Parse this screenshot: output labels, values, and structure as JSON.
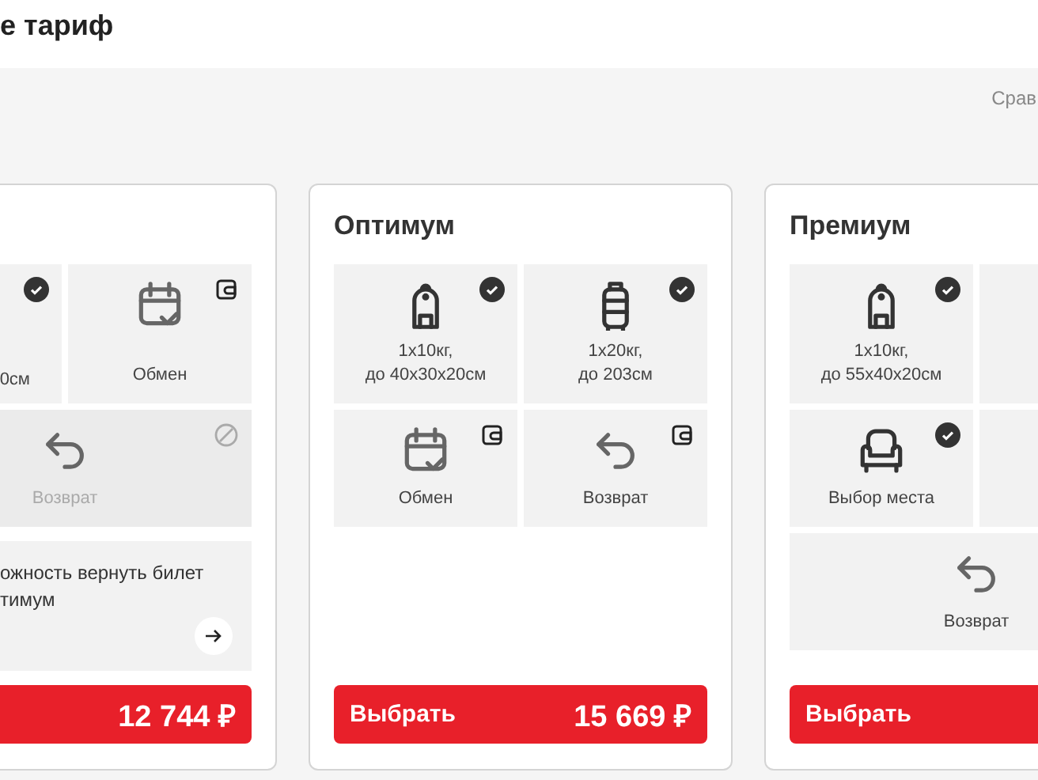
{
  "header": {
    "title": "е тариф",
    "compare_link": "Срав"
  },
  "tariffs": [
    {
      "features": [
        {
          "label": "0см",
          "included": true,
          "paid": false,
          "disabled": false
        },
        {
          "kind": "calendar",
          "label": "Обмен",
          "included": false,
          "paid": true,
          "disabled": false
        },
        {
          "kind": "return",
          "label": "Возврат",
          "included": false,
          "paid": false,
          "disabled": true
        }
      ],
      "info": {
        "text": "ожность вернуть билет\nтимум"
      },
      "price": "12 744 ₽"
    },
    {
      "title": "Оптимум",
      "features": [
        {
          "kind": "backpack",
          "label": "1x10кг,\nдо 40x30x20см",
          "included": true,
          "paid": false,
          "disabled": false
        },
        {
          "kind": "suitcase",
          "label": "1x20кг,\nдо 203см",
          "included": true,
          "paid": false,
          "disabled": false
        },
        {
          "kind": "calendar",
          "label": "Обмен",
          "included": false,
          "paid": true,
          "disabled": false
        },
        {
          "kind": "return",
          "label": "Возврат",
          "included": false,
          "paid": true,
          "disabled": false
        }
      ],
      "select_label": "Выбрать",
      "price": "15 669 ₽"
    },
    {
      "title": "Премиум",
      "features": [
        {
          "kind": "backpack",
          "label": "1x10кг,\nдо 55x40x20см",
          "included": true,
          "paid": false,
          "disabled": false
        },
        {
          "included": false,
          "paid": false,
          "disabled": false
        },
        {
          "kind": "seat",
          "label": "Выбор места",
          "included": true,
          "paid": false,
          "disabled": false
        },
        {
          "included": false,
          "paid": false,
          "disabled": false
        },
        {
          "kind": "return",
          "label": "Возврат",
          "included": false,
          "paid": false,
          "disabled": false
        }
      ],
      "select_label": "Выбрать"
    }
  ]
}
